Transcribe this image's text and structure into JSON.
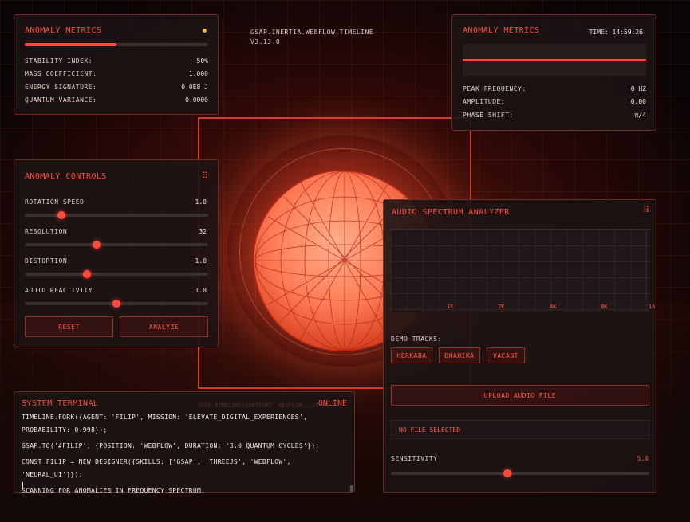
{
  "header": {
    "library_line1": "GSAP.INERTIA.WEBFLOW.TIMELINE",
    "library_line2": "V3.13.0"
  },
  "metrics_panel": {
    "title": "ANOMALY METRICS",
    "progress": 0.5,
    "rows": [
      {
        "label": "STABILITY INDEX:",
        "value": "50%"
      },
      {
        "label": "MASS COEFFICIENT:",
        "value": "1.000"
      },
      {
        "label": "ENERGY SIGNATURE:",
        "value": "0.0E8 J"
      },
      {
        "label": "QUANTUM VARIANCE:",
        "value": "0.0000"
      }
    ]
  },
  "wave_panel": {
    "title": "ANOMALY METRICS",
    "time": "TIME: 14:59:26",
    "rows": [
      {
        "label": "PEAK FREQUENCY:",
        "value": "0 HZ"
      },
      {
        "label": "AMPLITUDE:",
        "value": "0.00"
      },
      {
        "label": "PHASE SHIFT:",
        "value": "π/4"
      }
    ]
  },
  "controls_panel": {
    "title": "ANOMALY CONTROLS",
    "sliders": [
      {
        "label": "ROTATION SPEED",
        "value": "1.0",
        "level": 0.2
      },
      {
        "label": "RESOLUTION",
        "value": "32",
        "level": 0.39
      },
      {
        "label": "DISTORTION",
        "value": "1.0",
        "level": 0.34
      },
      {
        "label": "AUDIO REACTIVITY",
        "value": "1.0",
        "level": 0.5
      }
    ],
    "reset_label": "RESET",
    "analyze_label": "ANALYZE"
  },
  "analyzer_panel": {
    "title": "AUDIO SPECTRUM ANALYZER",
    "freq_labels": [
      "1K",
      "2K",
      "4K",
      "8K",
      "16"
    ],
    "demo_tracks_label": "DEMO TRACKS:",
    "tracks": [
      "HERKABA",
      "DHAHIKA",
      "VACANT"
    ],
    "upload_label": "UPLOAD AUDIO FILE",
    "file_status": "NO FILE SELECTED",
    "sensitivity_label": "SENSITIVITY",
    "sensitivity_value": "5.0",
    "sensitivity_level": 0.45
  },
  "terminal": {
    "title": "SYSTEM TERMINAL",
    "status": "ONLINE",
    "ghost_text": "GSAP.TIMELINE({ONSTART: WEBFLOW...X2.ANIMATION SEQUENCE(0X4F2E)",
    "lines": [
      "TIMELINE.FORK({AGENT: 'FILIP', MISSION: 'ELEVATE_DIGITAL_EXPERIENCES',",
      "PROBABILITY: 0.998});",
      "GSAP.TO('#FILIP', {POSITION: 'WEBFLOW', DURATION: '3.0 QUANTUM_CYCLES'});",
      "CONST FILIP = NEW DESIGNER({SKILLS: ['GSAP', 'THREEJS', 'WEBFLOW', 'NEURAL_UI']});",
      "SCANNING FOR ANOMALIES IN FREQUENCY SPECTRUM."
    ]
  },
  "colors": {
    "accent": "#ff4a3a",
    "background": "#0e0606",
    "panel": "#1c1414"
  }
}
